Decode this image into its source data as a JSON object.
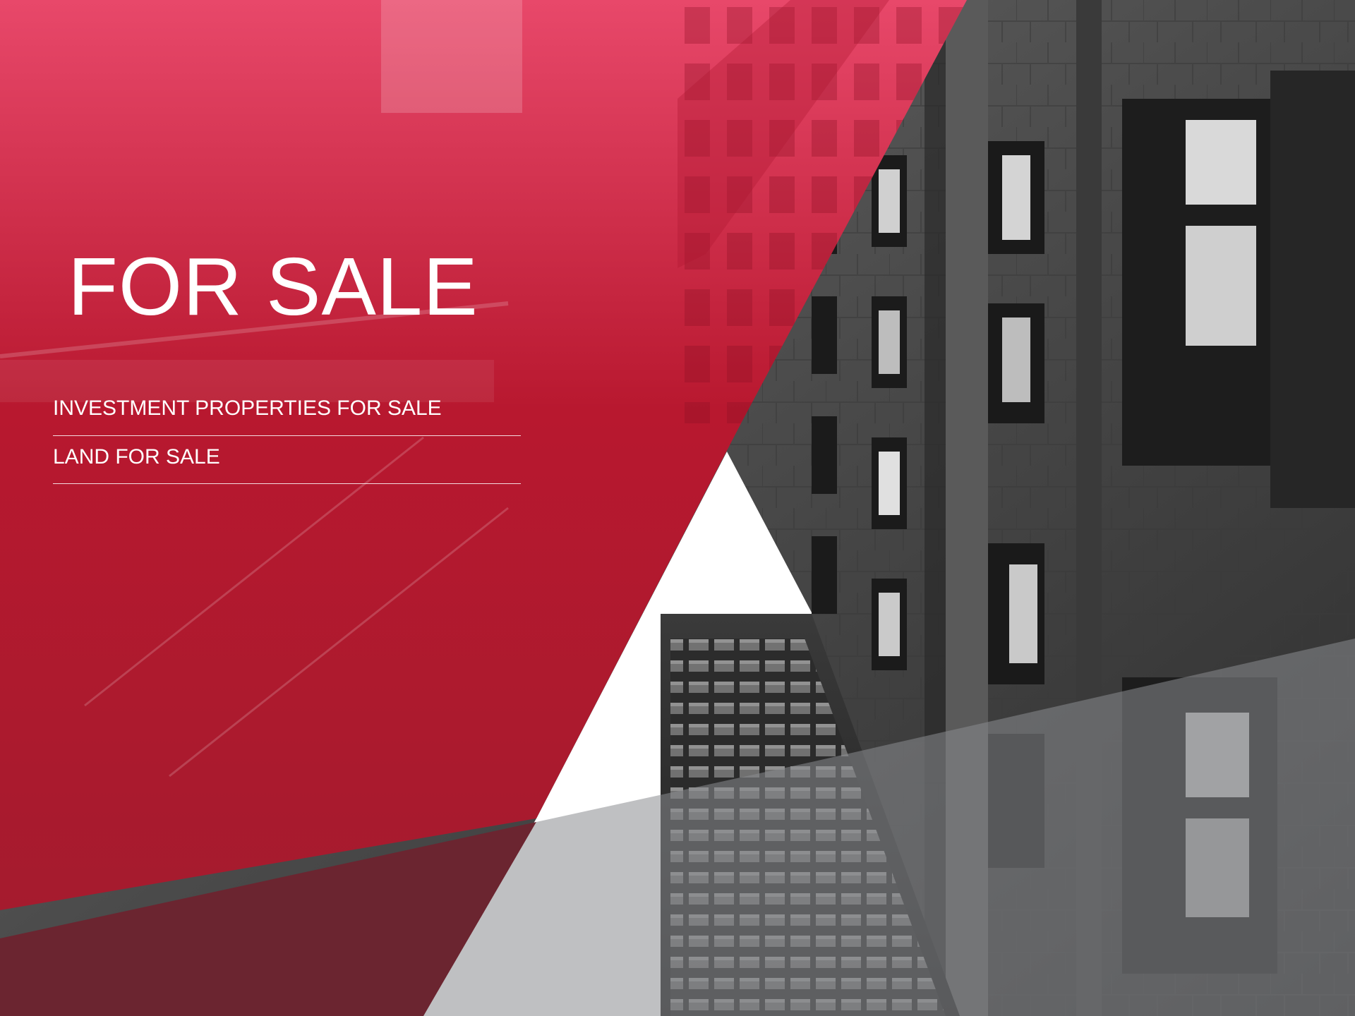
{
  "hero": {
    "title": "FOR SALE"
  },
  "menu": {
    "items": [
      {
        "label": "INVESTMENT PROPERTIES FOR SALE"
      },
      {
        "label": "LAND FOR SALE"
      }
    ]
  },
  "colors": {
    "accent_red": "#c8203c",
    "accent_red_light": "#e2455f",
    "dark_red_overlay": "#6b2530",
    "sky_white": "#ffffff",
    "gray_overlay": "#8a8d8f",
    "text": "#ffffff"
  }
}
